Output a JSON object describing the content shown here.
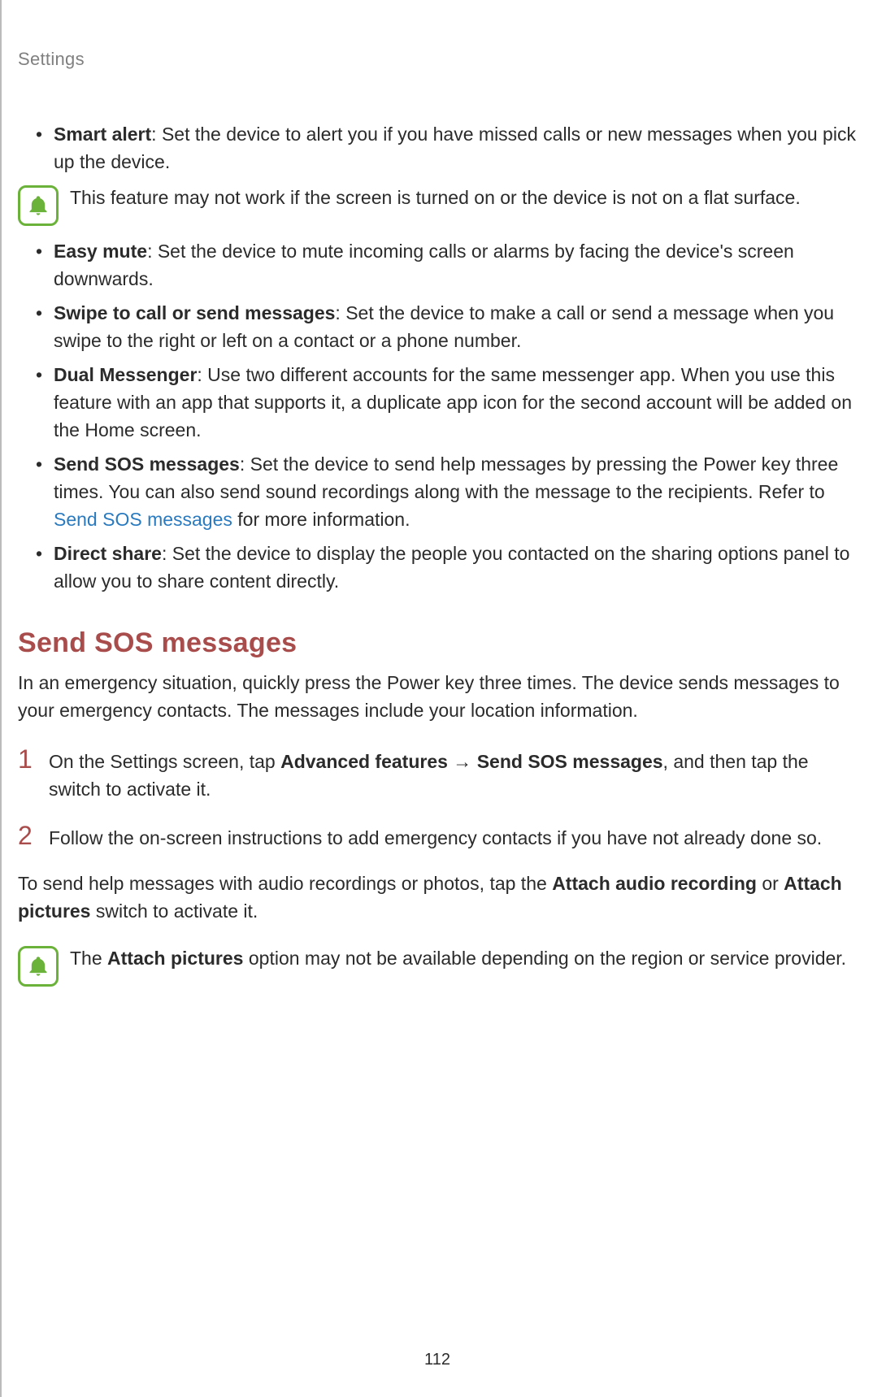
{
  "header": "Settings",
  "bullets_top": [
    {
      "title": "Smart alert",
      "desc": ": Set the device to alert you if you have missed calls or new messages when you pick up the device."
    }
  ],
  "note1": "This feature may not work if the screen is turned on or the device is not on a flat surface.",
  "bullets_mid": [
    {
      "title": "Easy mute",
      "desc": ": Set the device to mute incoming calls or alarms by facing the device's screen downwards."
    },
    {
      "title": "Swipe to call or send messages",
      "desc": ": Set the device to make a call or send a message when you swipe to the right or left on a contact or a phone number."
    },
    {
      "title": "Dual Messenger",
      "desc": ": Use two different accounts for the same messenger app. When you use this feature with an app that supports it, a duplicate app icon for the second account will be added on the Home screen."
    }
  ],
  "sos_bullet": {
    "title": "Send SOS messages",
    "before_link": ": Set the device to send help messages by pressing the Power key three times. You can also send sound recordings along with the message to the recipients. Refer to ",
    "link": "Send SOS messages",
    "after_link": " for more information."
  },
  "direct_share": {
    "title": "Direct share",
    "desc": ": Set the device to display the people you contacted on the sharing options panel to allow you to share content directly."
  },
  "section_title": "Send SOS messages",
  "section_intro": "In an emergency situation, quickly press the Power key three times. The device sends messages to your emergency contacts. The messages include your location information.",
  "step1": {
    "num": "1",
    "pre": "On the Settings screen, tap ",
    "b1": "Advanced features",
    "arrow": " → ",
    "b2": "Send SOS messages",
    "post": ", and then tap the switch to activate it."
  },
  "step2": {
    "num": "2",
    "text": "Follow the on-screen instructions to add emergency contacts if you have not already done so."
  },
  "attach_para": {
    "pre": "To send help messages with audio recordings or photos, tap the ",
    "b1": "Attach audio recording",
    "mid": " or ",
    "b2": "Attach pictures",
    "post": " switch to activate it."
  },
  "note2": {
    "pre": "The ",
    "b1": "Attach pictures",
    "post": " option may not be available depending on the region or service provider."
  },
  "page_number": "112"
}
